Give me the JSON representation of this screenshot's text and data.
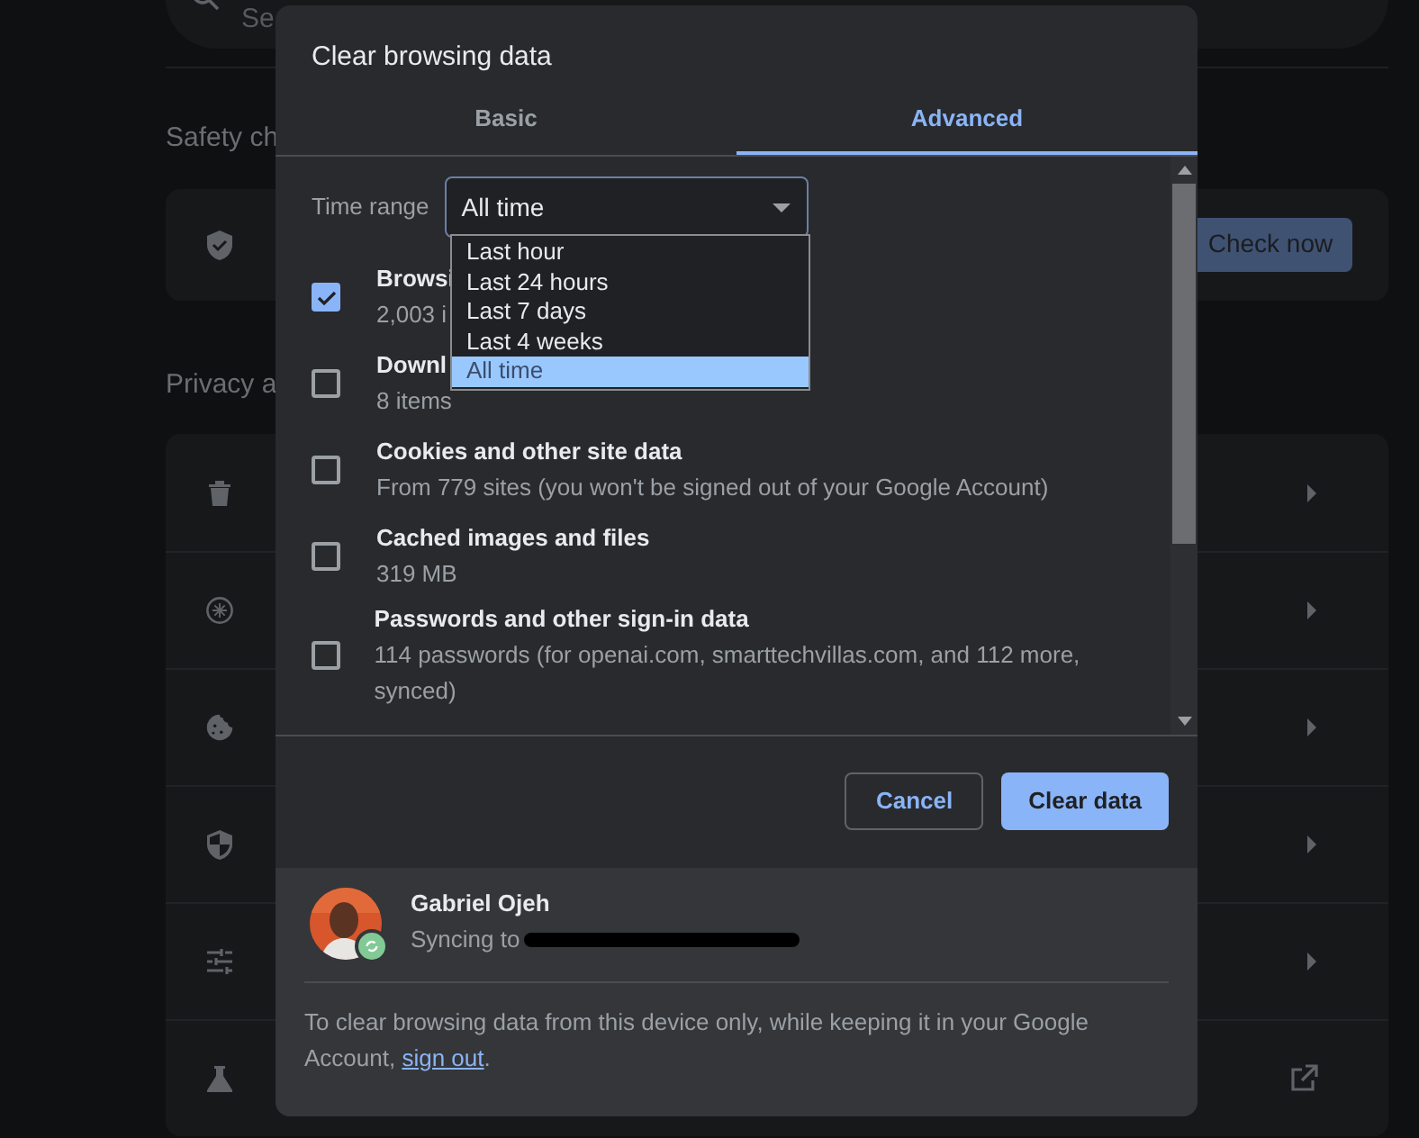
{
  "background": {
    "search": {
      "placeholder": "Se"
    },
    "safety_check": {
      "heading": "Safety ch",
      "button": "Check now"
    },
    "privacy": {
      "heading": "Privacy a",
      "rows": [
        {
          "kind": "trash",
          "external_link": false
        },
        {
          "kind": "compass",
          "external_link": false
        },
        {
          "kind": "cookie",
          "external_link": false
        },
        {
          "kind": "shield",
          "external_link": false
        },
        {
          "kind": "sliders",
          "external_link": false
        },
        {
          "kind": "flask",
          "external_link": true
        }
      ]
    }
  },
  "dialog": {
    "title": "Clear browsing data",
    "tabs": [
      {
        "label": "Basic",
        "selected": false
      },
      {
        "label": "Advanced",
        "selected": true
      }
    ],
    "time_range": {
      "label": "Time range",
      "value": "All time",
      "expanded": true,
      "options": [
        {
          "label": "Last hour",
          "selected": false
        },
        {
          "label": "Last 24 hours",
          "selected": false
        },
        {
          "label": "Last 7 days",
          "selected": false
        },
        {
          "label": "Last 4 weeks",
          "selected": false
        },
        {
          "label": "All time",
          "selected": true
        }
      ]
    },
    "items": [
      {
        "title": "Browsi",
        "detail": "2,003 i",
        "checked": true
      },
      {
        "title": "Downl",
        "detail": "8 items",
        "checked": false
      },
      {
        "title": "Cookies and other site data",
        "detail": "From 779 sites (you won't be signed out of your Google Account)",
        "checked": false
      },
      {
        "title": "Cached images and files",
        "detail": "319 MB",
        "checked": false
      },
      {
        "title": "Passwords and other sign-in data",
        "detail": "114 passwords (for openai.com, smarttechvillas.com, and 112 more, synced)",
        "checked": false
      }
    ],
    "buttons": [
      {
        "label": "Cancel",
        "kind": "secondary"
      },
      {
        "label": "Clear data",
        "kind": "primary"
      }
    ],
    "account": {
      "name": "Gabriel Ojeh",
      "status": "Syncing to",
      "syncing": true
    },
    "note": {
      "text": "To clear browsing data from this device only, while keeping it in your Google Account,",
      "link": "sign out",
      "end": "."
    }
  }
}
